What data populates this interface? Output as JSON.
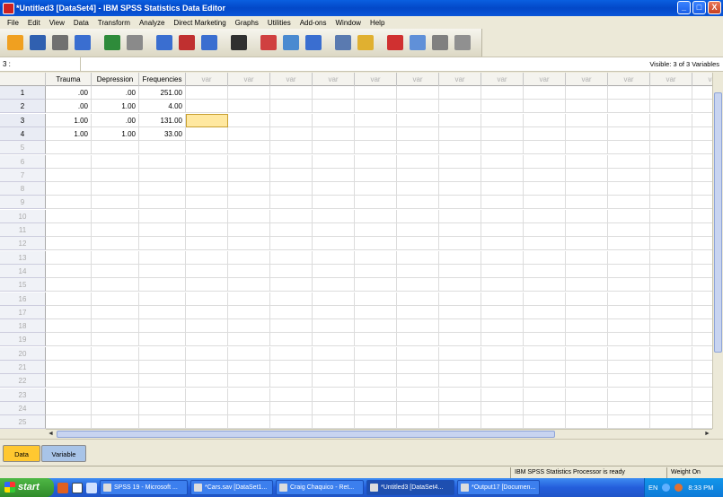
{
  "window": {
    "title": "*Untitled3 [DataSet4] - IBM SPSS Statistics Data Editor",
    "buttons": {
      "minimize": "_",
      "maximize": "□",
      "close": "X"
    }
  },
  "menu": [
    "File",
    "Edit",
    "View",
    "Data",
    "Transform",
    "Analyze",
    "Direct Marketing",
    "Graphs",
    "Utilities",
    "Add-ons",
    "Window",
    "Help"
  ],
  "toolbar": [
    {
      "icon": "open-folder-icon",
      "color": "#f0a020"
    },
    {
      "icon": "save-icon",
      "color": "#3060b0"
    },
    {
      "icon": "print-icon",
      "color": "#707070"
    },
    {
      "icon": "dialog-recall-icon",
      "color": "#3a6ed0"
    },
    {
      "icon": "undo-icon",
      "color": "#2e8b3a"
    },
    {
      "icon": "redo-icon",
      "color": "#8a8a8a"
    },
    {
      "icon": "goto-case-icon",
      "color": "#3a6ed0"
    },
    {
      "icon": "goto-variable-icon",
      "color": "#c03030"
    },
    {
      "icon": "variables-icon",
      "color": "#3a6ed0"
    },
    {
      "icon": "find-icon",
      "color": "#303030"
    },
    {
      "icon": "insert-cases-icon",
      "color": "#d04040"
    },
    {
      "icon": "insert-variable-icon",
      "color": "#4a8ad0"
    },
    {
      "icon": "split-file-icon",
      "color": "#3a6ed0"
    },
    {
      "icon": "weight-cases-icon",
      "color": "#5a7ab0"
    },
    {
      "icon": "select-cases-icon",
      "color": "#e0b030"
    },
    {
      "icon": "value-labels-icon",
      "color": "#d03030"
    },
    {
      "icon": "use-sets-icon",
      "color": "#6090d8"
    },
    {
      "icon": "show-all-variables-icon",
      "color": "#808080"
    },
    {
      "icon": "spell-check-icon",
      "color": "#909090"
    }
  ],
  "cell_editor": {
    "ref": "3 :",
    "visible": "Visible: 3 of 3 Variables"
  },
  "grid": {
    "columns": [
      "Trauma",
      "Depression",
      "Frequencies",
      "var",
      "var",
      "var",
      "var",
      "var",
      "var",
      "var",
      "var",
      "var",
      "var",
      "var",
      "var",
      "var"
    ],
    "rows": [
      [
        "1",
        ".00",
        ".00",
        "251.00"
      ],
      [
        "2",
        ".00",
        "1.00",
        "4.00"
      ],
      [
        "3",
        "1.00",
        ".00",
        "131.00"
      ],
      [
        "4",
        "1.00",
        "1.00",
        "33.00"
      ],
      [
        "5"
      ],
      [
        "6"
      ],
      [
        "7"
      ],
      [
        "8"
      ],
      [
        "9"
      ],
      [
        "10"
      ],
      [
        "11"
      ],
      [
        "12"
      ],
      [
        "13"
      ],
      [
        "14"
      ],
      [
        "15"
      ],
      [
        "16"
      ],
      [
        "17"
      ],
      [
        "18"
      ],
      [
        "19"
      ],
      [
        "20"
      ],
      [
        "21"
      ],
      [
        "22"
      ],
      [
        "23"
      ],
      [
        "24"
      ],
      [
        "25"
      ]
    ],
    "selected_row": 3,
    "selected_col": 4
  },
  "tabs": {
    "data_view": "Data View",
    "variable_view": "Variable View"
  },
  "status": {
    "processor": "IBM SPSS Statistics Processor is ready",
    "weight": "Weight On"
  },
  "taskbar": {
    "start": "start",
    "items": [
      {
        "label": "SPSS 19 - Microsoft ...",
        "active": false
      },
      {
        "label": "*Cars.sav [DataSet1...",
        "active": false
      },
      {
        "label": "Craig Chaquico - Ret...",
        "active": false
      },
      {
        "label": "*Untitled3 [DataSet4...",
        "active": true
      },
      {
        "label": "*Output17 [Documen...",
        "active": false
      }
    ],
    "lang": "EN",
    "clock": "8:33 PM"
  },
  "colors": {
    "selected_cell": "#ffe8a0",
    "active_tab": "#ffc830",
    "titlebar": "#0348c8"
  }
}
